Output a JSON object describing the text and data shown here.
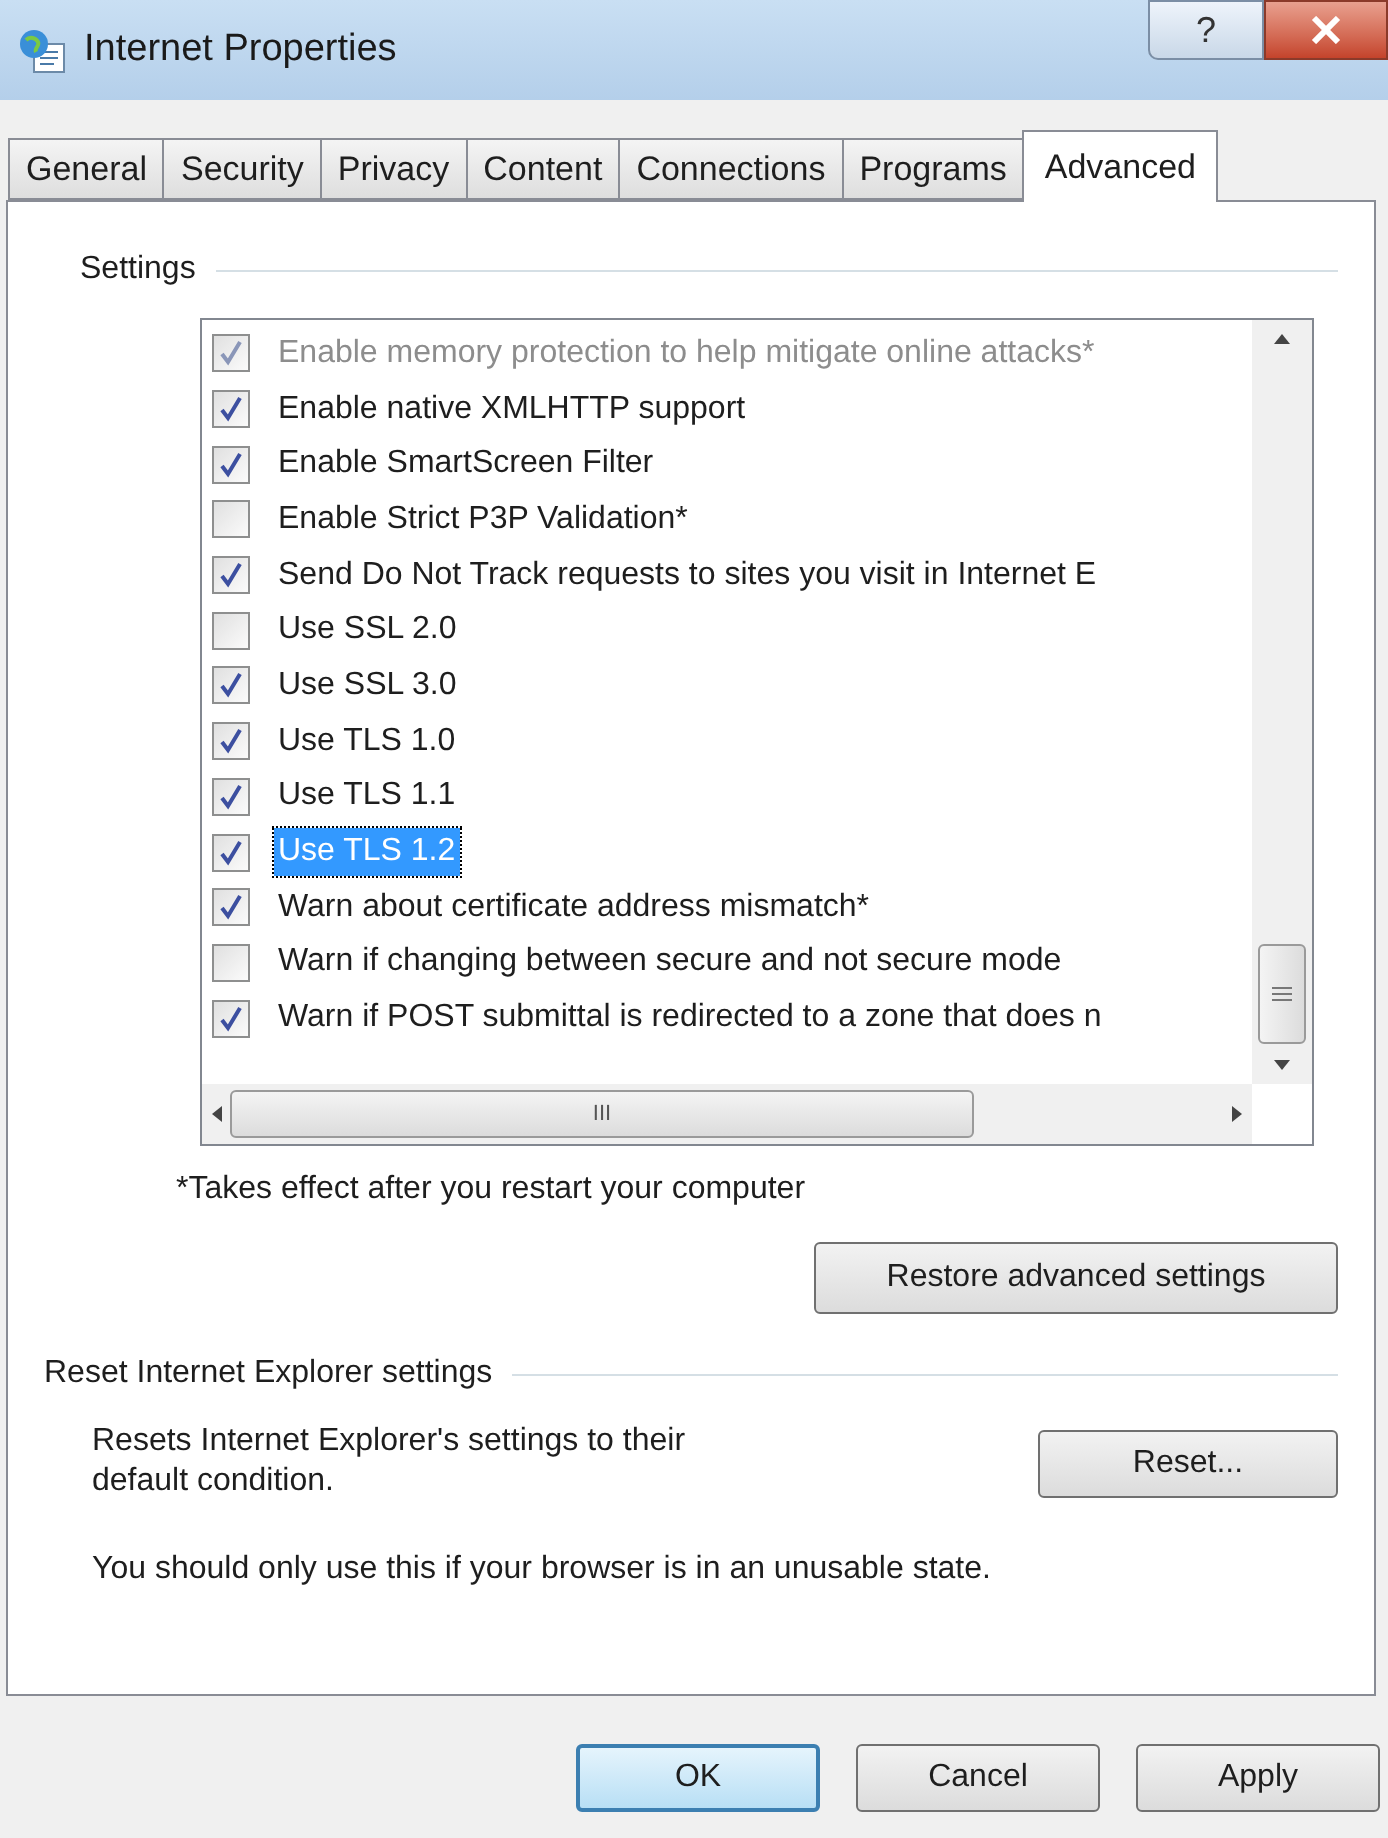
{
  "window": {
    "title": "Internet Properties",
    "help_glyph": "?"
  },
  "tabs": [
    {
      "label": "General",
      "selected": false
    },
    {
      "label": "Security",
      "selected": false
    },
    {
      "label": "Privacy",
      "selected": false
    },
    {
      "label": "Content",
      "selected": false
    },
    {
      "label": "Connections",
      "selected": false
    },
    {
      "label": "Programs",
      "selected": false
    },
    {
      "label": "Advanced",
      "selected": true
    }
  ],
  "settings": {
    "title": "Settings",
    "items": [
      {
        "label": "Enable memory protection to help mitigate online attacks*",
        "checked": true,
        "disabled": true,
        "selected": false
      },
      {
        "label": "Enable native XMLHTTP support",
        "checked": true,
        "disabled": false,
        "selected": false
      },
      {
        "label": "Enable SmartScreen Filter",
        "checked": true,
        "disabled": false,
        "selected": false
      },
      {
        "label": "Enable Strict P3P Validation*",
        "checked": false,
        "disabled": false,
        "selected": false
      },
      {
        "label": "Send Do Not Track requests to sites you visit in Internet E",
        "checked": true,
        "disabled": false,
        "selected": false
      },
      {
        "label": "Use SSL 2.0",
        "checked": false,
        "disabled": false,
        "selected": false
      },
      {
        "label": "Use SSL 3.0",
        "checked": true,
        "disabled": false,
        "selected": false
      },
      {
        "label": "Use TLS 1.0",
        "checked": true,
        "disabled": false,
        "selected": false
      },
      {
        "label": "Use TLS 1.1",
        "checked": true,
        "disabled": false,
        "selected": false
      },
      {
        "label": "Use TLS 1.2",
        "checked": true,
        "disabled": false,
        "selected": true
      },
      {
        "label": "Warn about certificate address mismatch*",
        "checked": true,
        "disabled": false,
        "selected": false
      },
      {
        "label": "Warn if changing between secure and not secure mode",
        "checked": false,
        "disabled": false,
        "selected": false
      },
      {
        "label": "Warn if POST submittal is redirected to a zone that does n",
        "checked": true,
        "disabled": false,
        "selected": false
      }
    ],
    "scrollbar_grip": "III",
    "footnote": "*Takes effect after you restart your computer",
    "restore_button": "Restore advanced settings"
  },
  "reset": {
    "title": "Reset Internet Explorer settings",
    "description": "Resets Internet Explorer's settings to their default condition.",
    "button": "Reset...",
    "warning": "You should only use this if your browser is in an unusable state."
  },
  "buttons": [
    {
      "label": "OK",
      "default": true
    },
    {
      "label": "Cancel",
      "default": false
    },
    {
      "label": "Apply",
      "default": false
    }
  ]
}
